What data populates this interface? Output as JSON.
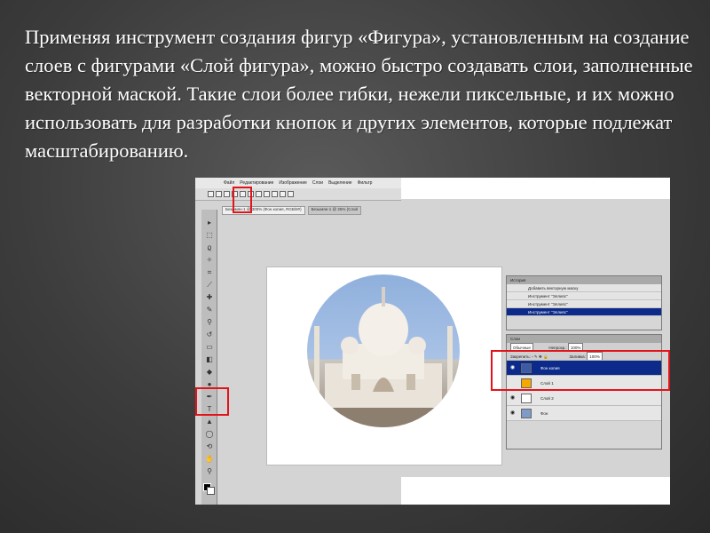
{
  "slide": {
    "paragraph": "Применяя инструмент создания фигур «Фигура», установленным на создание слоев с фигурами «Слой фигура», можно быстро создавать слои, заполненные векторной маской. Такие слои более гибки, нежели пиксельные, и их можно использовать для разработки кнопок и других элементов, которые подлежат масштабированию."
  },
  "app": {
    "menus": [
      "Файл",
      "Редактирование",
      "Изображение",
      "Слои",
      "Выделение",
      "Фильтр"
    ],
    "tabs": [
      "Безымян-1 @ 300% (Фон копия, RGB/8#)",
      "Безымян-1 @ 25% (Слой"
    ]
  },
  "history_panel": {
    "title": "История",
    "items": [
      {
        "label": "Добавить векторную маску",
        "selected": false
      },
      {
        "label": "Инструмент \"Эллипс\"",
        "selected": false
      },
      {
        "label": "Инструмент \"Эллипс\"",
        "selected": false
      },
      {
        "label": "Инструмент \"Эллипс\"",
        "selected": true
      }
    ]
  },
  "layers_panel": {
    "title": "Слои",
    "blend_mode": "Обычные",
    "opacity_label": "Непрозр.:",
    "opacity_value": "100%",
    "lock_label": "Закрепить:",
    "fill_label": "Заливка:",
    "fill_value": "100%",
    "layers": [
      {
        "name": "Фон копия",
        "selected": true,
        "thumb_color": "#3b5aa8"
      },
      {
        "name": "Слой 1",
        "selected": false,
        "thumb_color": "#f5a800"
      },
      {
        "name": "Слой 2",
        "selected": false,
        "thumb_color": "#ffffff"
      },
      {
        "name": "Фон",
        "selected": false,
        "thumb_color": "#7f9cc9"
      }
    ]
  },
  "colors": {
    "highlight_red": "#e2141a",
    "selection_blue": "#0c2a8a"
  }
}
